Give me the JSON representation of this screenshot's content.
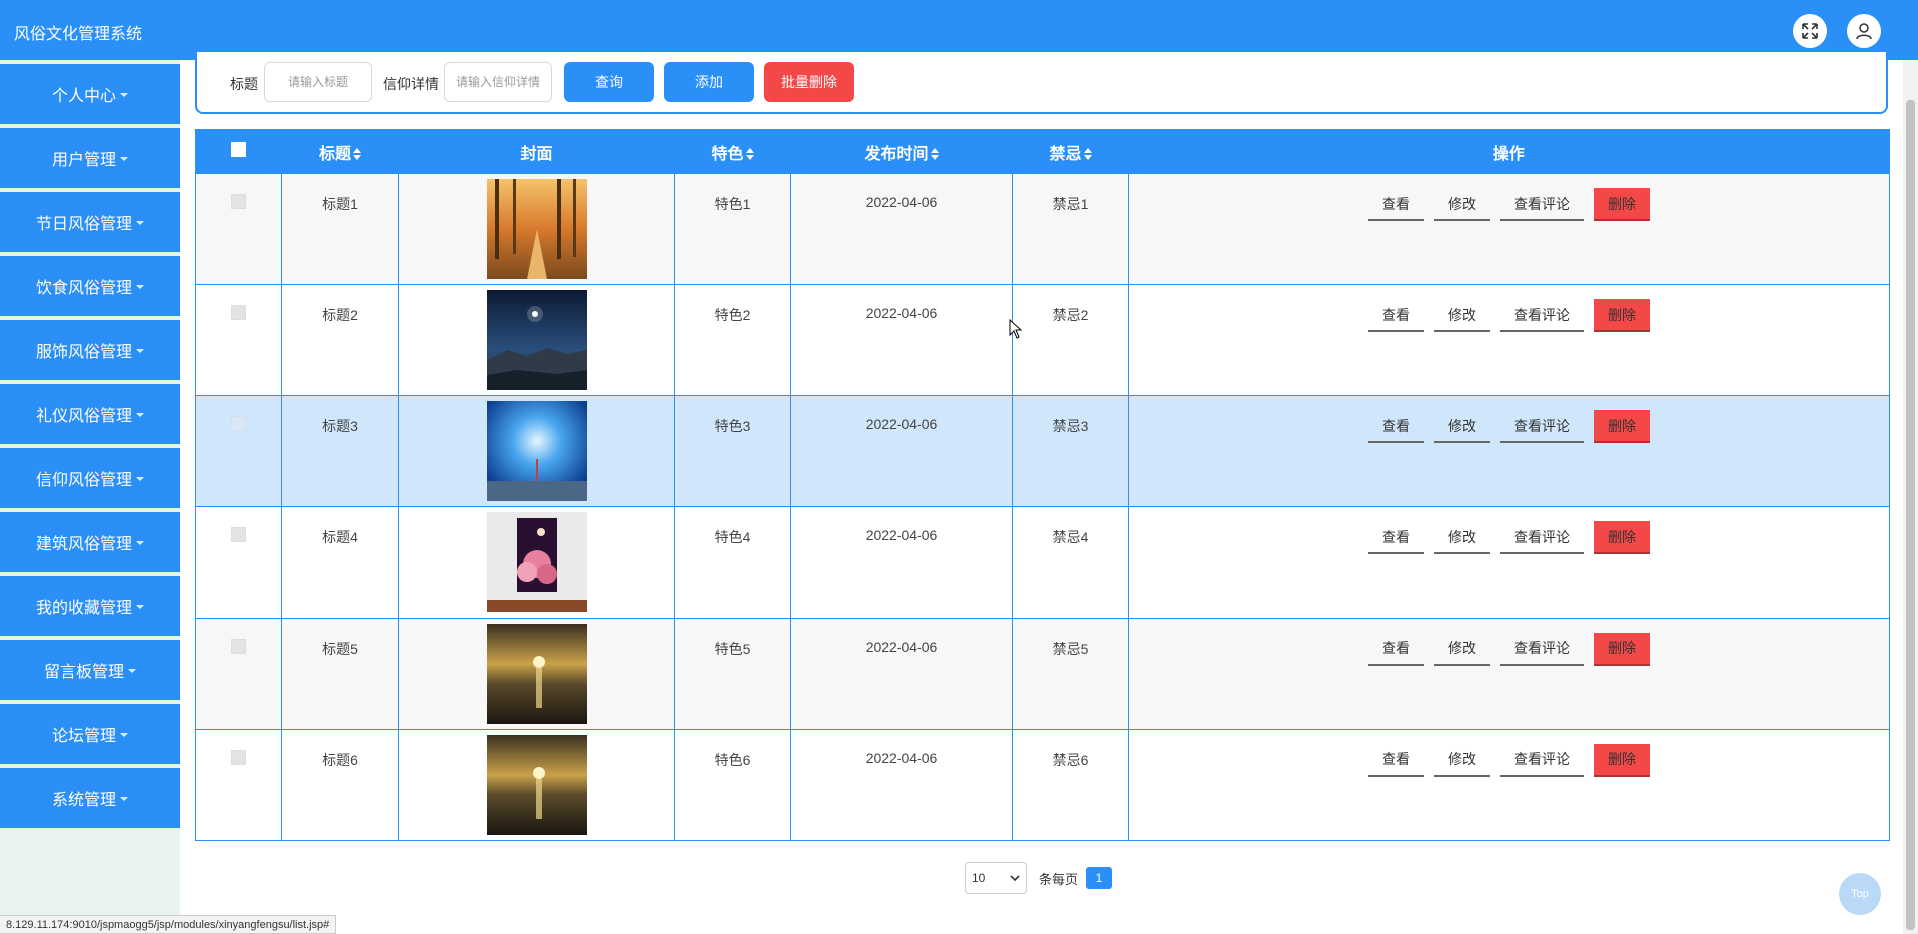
{
  "header": {
    "title": "风俗文化管理系统"
  },
  "sidebar": {
    "items": [
      {
        "label": "个人中心"
      },
      {
        "label": "用户管理"
      },
      {
        "label": "节日风俗管理"
      },
      {
        "label": "饮食风俗管理"
      },
      {
        "label": "服饰风俗管理"
      },
      {
        "label": "礼仪风俗管理"
      },
      {
        "label": "信仰风俗管理"
      },
      {
        "label": "建筑风俗管理"
      },
      {
        "label": "我的收藏管理"
      },
      {
        "label": "留言板管理"
      },
      {
        "label": "论坛管理"
      },
      {
        "label": "系统管理"
      }
    ]
  },
  "search": {
    "title_label": "标题",
    "title_placeholder": "请输入标题",
    "belief_label": "信仰详情",
    "belief_placeholder": "请输入信仰详情",
    "query_button": "查询",
    "add_button": "添加",
    "batch_delete_button": "批量删除"
  },
  "table": {
    "headers": {
      "title": "标题",
      "cover": "封面",
      "feature": "特色",
      "time": "发布时间",
      "taboo": "禁忌",
      "ops": "操作"
    },
    "rows": [
      {
        "title": "标题1",
        "feature": "特色1",
        "time": "2022-04-06",
        "taboo": "禁忌1"
      },
      {
        "title": "标题2",
        "feature": "特色2",
        "time": "2022-04-06",
        "taboo": "禁忌2"
      },
      {
        "title": "标题3",
        "feature": "特色3",
        "time": "2022-04-06",
        "taboo": "禁忌3"
      },
      {
        "title": "标题4",
        "feature": "特色4",
        "time": "2022-04-06",
        "taboo": "禁忌4"
      },
      {
        "title": "标题5",
        "feature": "特色5",
        "time": "2022-04-06",
        "taboo": "禁忌5"
      },
      {
        "title": "标题6",
        "feature": "特色6",
        "time": "2022-04-06",
        "taboo": "禁忌6"
      }
    ],
    "ops": {
      "view": "查看",
      "edit": "修改",
      "view_comments": "查看评论",
      "delete": "删除"
    }
  },
  "pager": {
    "page_size": "10",
    "per_page_label": "条每页",
    "current_page": "1"
  },
  "status_url": "8.129.11.174:9010/jspmaogg5/jsp/modules/xinyangfengsu/list.jsp#",
  "to_top_label": "Top",
  "colors": {
    "primary": "#2a8ff7",
    "danger": "#f44848",
    "selected_row": "#d0e7fb"
  }
}
